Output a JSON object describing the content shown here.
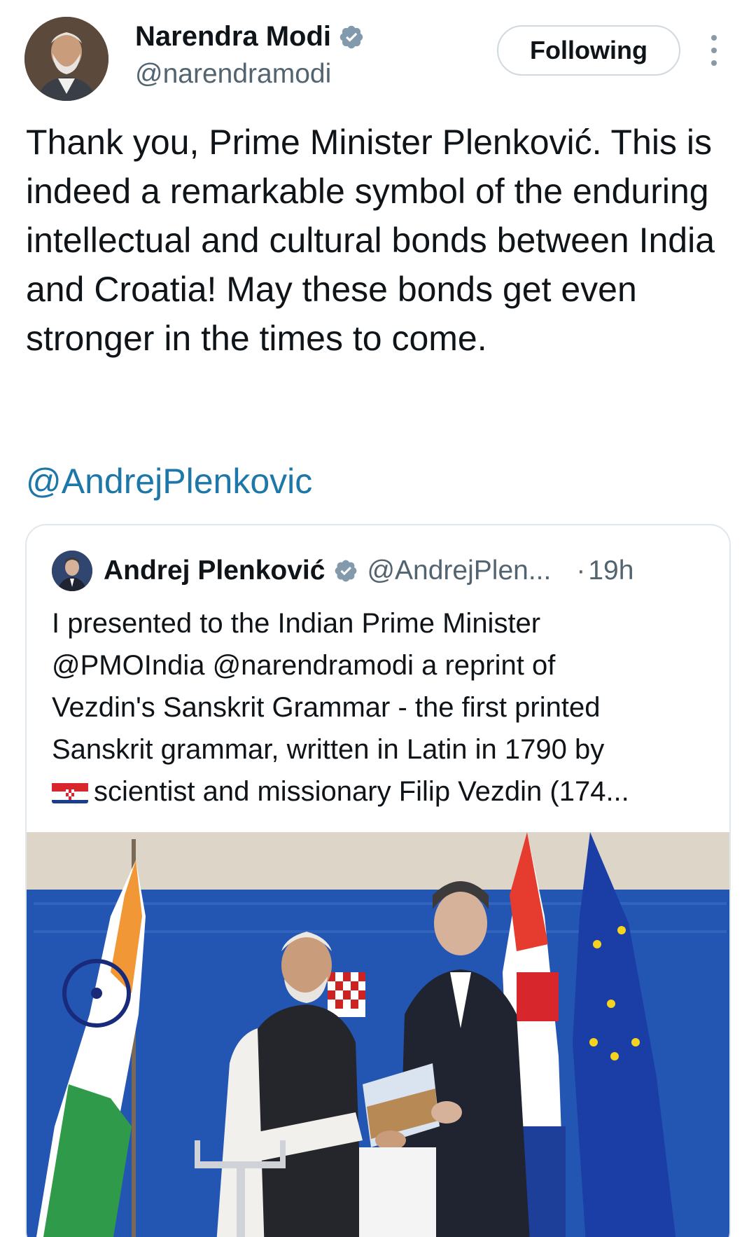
{
  "tweet": {
    "author_name": "Narendra Modi",
    "author_handle": "@narendramodi",
    "follow_label": "Following",
    "text": "Thank you, Prime Minister Plenković. This is indeed a remarkable symbol of the enduring intellectual and cultural bonds between India and Croatia! May these bonds get even stronger in the times to come.",
    "mention": "@AndrejPlenkovic"
  },
  "quote": {
    "author_name": "Andrej Plenković",
    "author_handle": "@AndrejPlen...",
    "separator": "·",
    "time": "19h",
    "text_lines": [
      "I presented to the Indian Prime Minister",
      "@PMOIndia @narendramodi a reprint of",
      "Vezdin's Sanskrit Grammar - the first printed",
      "Sanskrit grammar, written in Latin in 1790 by"
    ],
    "last_line": "scientist and missionary Filip Vezdin (174..."
  },
  "colors": {
    "link": "#1d77a8",
    "secondary_text": "#536471",
    "verified_badge": "#829aab",
    "backdrop_blue": "#2355b3"
  },
  "icons": [
    "verified-badge-icon",
    "more-options-icon",
    "croatia-flag-emoji"
  ]
}
